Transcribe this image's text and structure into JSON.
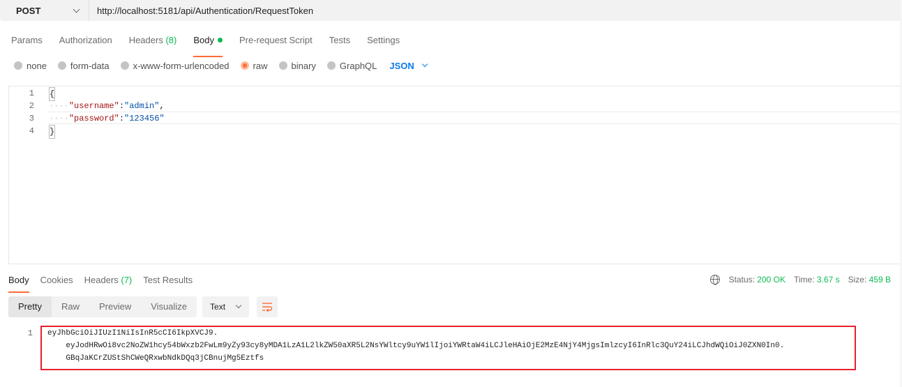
{
  "request": {
    "method": "POST",
    "url": "http://localhost:5181/api/Authentication/RequestToken"
  },
  "request_tabs": [
    {
      "label": "Params"
    },
    {
      "label": "Authorization"
    },
    {
      "label": "Headers",
      "count": "(8)"
    },
    {
      "label": "Body",
      "active": true
    },
    {
      "label": "Pre-request Script"
    },
    {
      "label": "Tests"
    },
    {
      "label": "Settings"
    }
  ],
  "body_types": [
    {
      "label": "none"
    },
    {
      "label": "form-data"
    },
    {
      "label": "x-www-form-urlencoded"
    },
    {
      "label": "raw",
      "checked": true
    },
    {
      "label": "binary"
    },
    {
      "label": "GraphQL"
    }
  ],
  "body_format": "JSON",
  "editor_lines": [
    {
      "num": "1",
      "text": "{"
    },
    {
      "num": "2",
      "indent": "····",
      "key": "\"username\"",
      "sep": ":",
      "value": "\"admin\"",
      "trail": ","
    },
    {
      "num": "3",
      "indent": "····",
      "key": "\"password\"",
      "sep": ":",
      "value": "\"123456\"",
      "trail": ""
    },
    {
      "num": "4",
      "text": "}"
    }
  ],
  "response_tabs": [
    {
      "label": "Body",
      "active": true
    },
    {
      "label": "Cookies"
    },
    {
      "label": "Headers",
      "count": "(7)"
    },
    {
      "label": "Test Results"
    }
  ],
  "response_meta": {
    "status_label": "Status:",
    "status_value": "200 OK",
    "time_label": "Time:",
    "time_value": "3.67 s",
    "size_label": "Size:",
    "size_value": "459 B"
  },
  "view_modes": [
    "Pretty",
    "Raw",
    "Preview",
    "Visualize"
  ],
  "response_format": "Text",
  "response_body": {
    "line_number": "1",
    "lines": [
      "eyJhbGciOiJIUzI1NiIsInR5cCI6IkpXVCJ9.",
      "    eyJodHRwOi8vc2NoZW1hcy54bWxzb2FwLm9yZy93cy8yMDA1LzA1L2lkZW50aXR5L2NsYWltcy9uYW1lIjoiYWRtaW4iLCJleHAiOjE2MzE4NjY4MjgsImlzcyI6InRlc3QuY24iLCJhdWQiOiJ0ZXN0In0.",
      "    GBqJaKCrZUStShCWeQRxwbNdkDQq3jCBnujMg5Eztfs"
    ]
  },
  "colors": {
    "accent": "#ff6c37",
    "success": "#0cbb52",
    "link": "#097bed",
    "highlight_border": "#e8202e"
  }
}
